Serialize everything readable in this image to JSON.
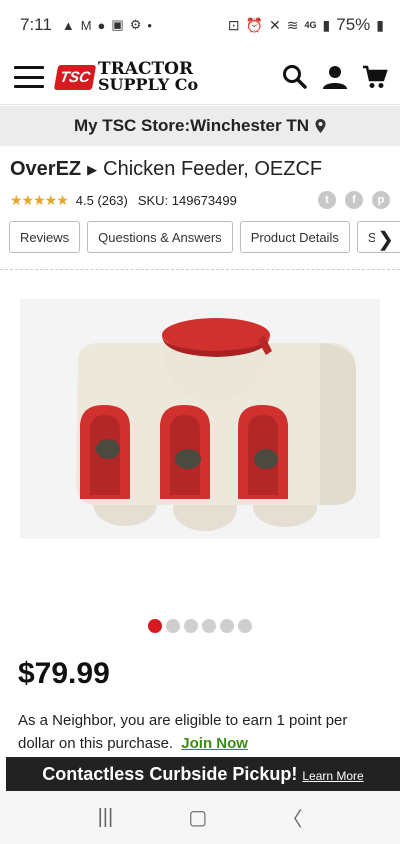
{
  "status": {
    "time": "7:11",
    "network": "4G",
    "battery": "75%"
  },
  "header": {
    "logo_badge": "TSC",
    "logo_line1": "TRACTOR",
    "logo_line2": "SUPPLY Co"
  },
  "store": {
    "label": "My TSC Store:Winchester TN"
  },
  "product": {
    "brand": "OverEZ",
    "name": "Chicken Feeder, OEZCF",
    "stars": "★★★★★",
    "rating": "4.5 (263)",
    "sku": "SKU: 149673499",
    "price": "$79.99"
  },
  "tabs": [
    {
      "label": "Reviews"
    },
    {
      "label": "Questions & Answers"
    },
    {
      "label": "Product Details"
    },
    {
      "label": "Spe"
    }
  ],
  "gallery": {
    "total": 6,
    "active_index": 0
  },
  "neighbor": {
    "text": "As a Neighbor, you are eligible to earn 1 point per dollar on this purchase.",
    "join": "Join Now"
  },
  "curbside": {
    "title": "Contactless Curbside Pickup!",
    "learn": "Learn More"
  },
  "colors": {
    "brand_red": "#d71920",
    "star": "#e5a528",
    "join_green": "#3d8b16"
  }
}
